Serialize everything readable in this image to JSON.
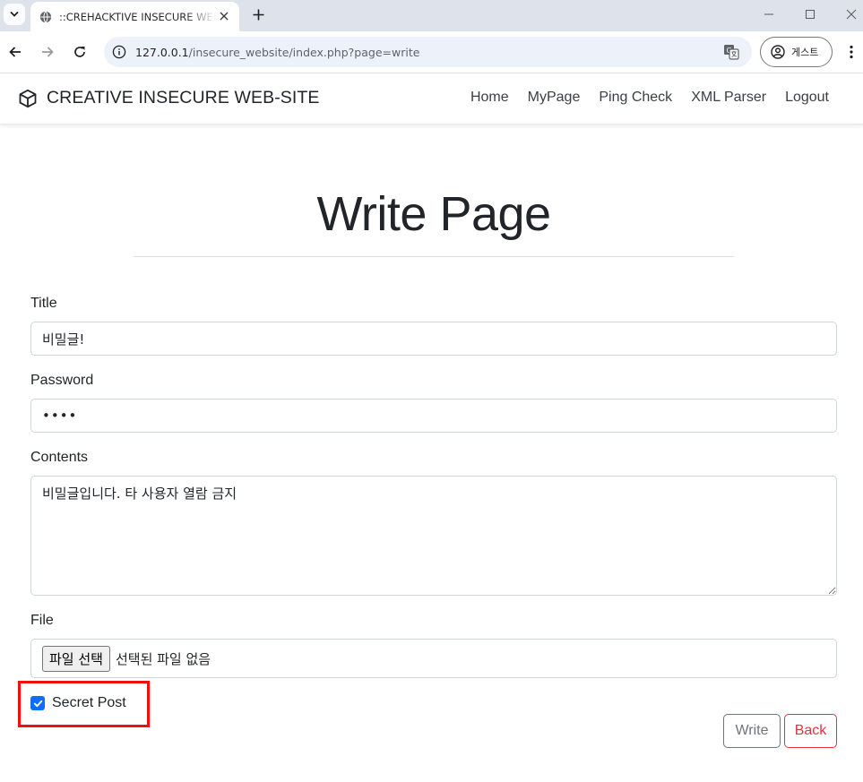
{
  "browser": {
    "tab_title": "::CREHACKTIVE INSECURE WEB-SITE::",
    "url_host": "127.0.0.1",
    "url_path": "/insecure_website/index.php?page=write",
    "profile_label": "게스트",
    "icons": [
      "tab-search-icon",
      "globe-icon",
      "close-icon",
      "plus-icon",
      "minimize-icon",
      "maximize-icon",
      "window-close-icon",
      "back-arrow-icon",
      "forward-arrow-icon",
      "reload-icon",
      "info-icon",
      "translate-icon",
      "profile-icon",
      "kebab-menu-icon"
    ]
  },
  "navbar": {
    "brand": "CREATIVE INSECURE WEB-SITE",
    "brand_icon": "box-icon",
    "links": [
      "Home",
      "MyPage",
      "Ping Check",
      "XML Parser",
      "Logout"
    ]
  },
  "page": {
    "heading": "Write Page"
  },
  "form": {
    "title_label": "Title",
    "title_value": "비밀글!",
    "password_label": "Password",
    "password_value": "1234",
    "contents_label": "Contents",
    "contents_value": "비밀글입니다. 타 사용자 열람 금지",
    "file_label": "File",
    "file_button": "파일 선택",
    "file_status": "선택된 파일 없음",
    "secret_label": "Secret Post",
    "secret_checked": true,
    "write_button": "Write",
    "back_button": "Back"
  },
  "colors": {
    "primary": "#0d6efd",
    "danger": "#dc3545",
    "secondary": "#6c757d",
    "highlight": "#ee1111"
  }
}
